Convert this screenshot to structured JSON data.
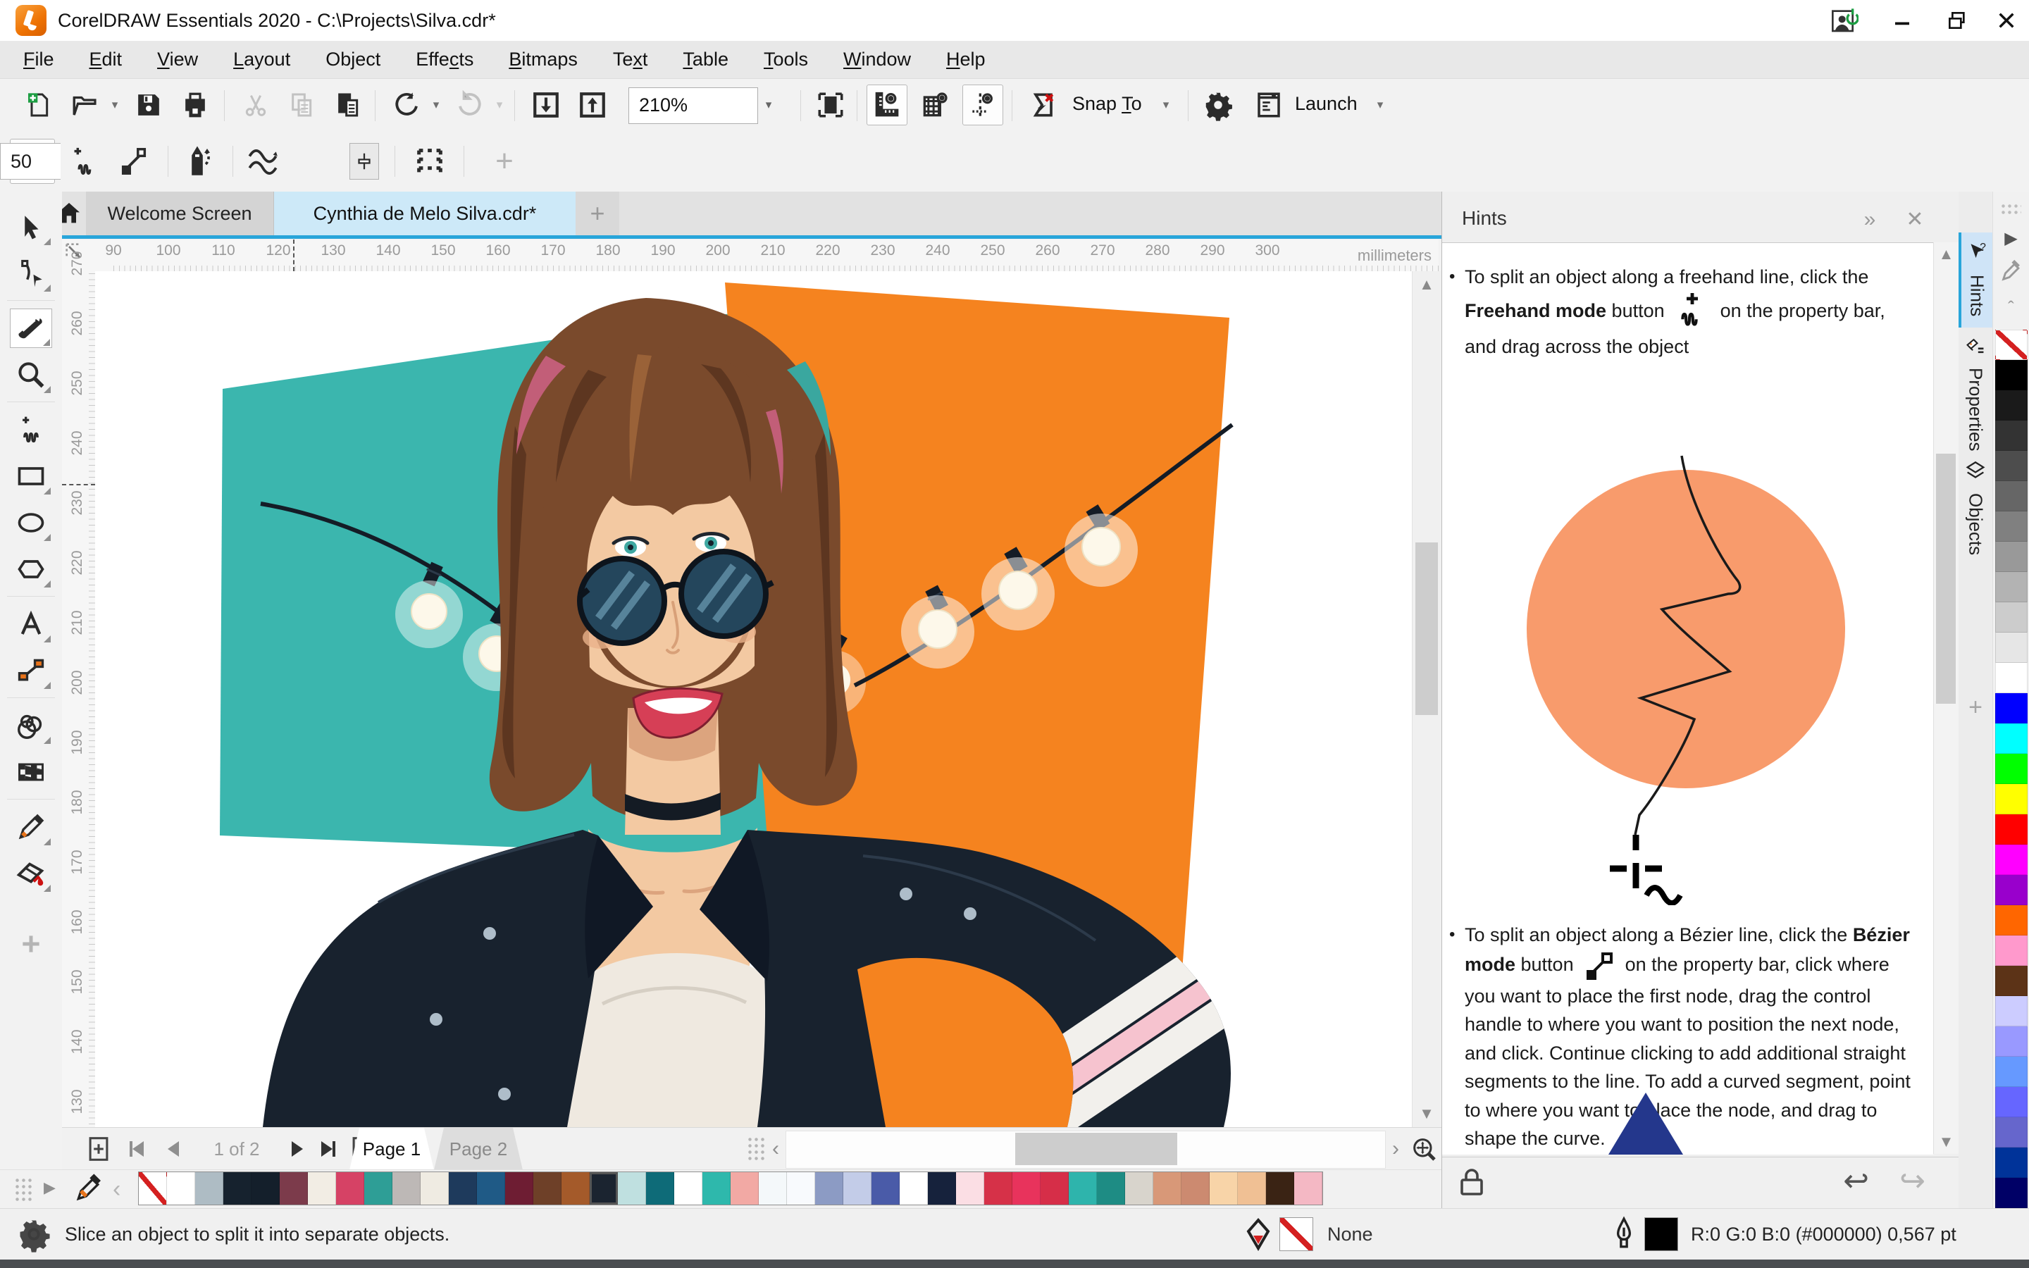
{
  "window": {
    "title": "CorelDRAW Essentials 2020 - C:\\Projects\\Silva.cdr*"
  },
  "menu": {
    "items": [
      {
        "label": "File",
        "underline": 0
      },
      {
        "label": "Edit",
        "underline": 0
      },
      {
        "label": "View",
        "underline": 0
      },
      {
        "label": "Layout",
        "underline": 0
      },
      {
        "label": "Object",
        "underline": 2
      },
      {
        "label": "Effects",
        "underline": 4
      },
      {
        "label": "Bitmaps",
        "underline": 0
      },
      {
        "label": "Text",
        "underline": 2
      },
      {
        "label": "Table",
        "underline": 0
      },
      {
        "label": "Tools",
        "underline": 0
      },
      {
        "label": "Window",
        "underline": 0
      },
      {
        "label": "Help",
        "underline": 0
      }
    ]
  },
  "toolbar": {
    "zoom_level": "210%",
    "snap_to": {
      "label": "Snap To",
      "underline": 5
    },
    "launch": "Launch",
    "icons": [
      "new-document-icon",
      "open-icon",
      "save-icon",
      "print-icon",
      "cut-icon",
      "copy-icon",
      "paste-icon",
      "undo-icon",
      "redo-icon",
      "import-icon",
      "export-icon",
      "page-fit-icon",
      "rulers-icon",
      "grid-icon",
      "guidelines-icon",
      "snap-off-icon",
      "options-gear-icon",
      "launch-icon"
    ]
  },
  "property_bar": {
    "smoothing_value": "50",
    "icons": [
      "two-point-line-icon",
      "freehand-mode-icon",
      "bezier-mode-icon",
      "pencil-curve-icon",
      "smoothing-icon",
      "slider-icon",
      "border-dots-icon",
      "plus-icon"
    ]
  },
  "document_tabs": {
    "welcome": "Welcome Screen",
    "document": "Cynthia de Melo Silva.cdr*"
  },
  "rulers": {
    "units": "millimeters",
    "horizontal_labels": [
      90,
      100,
      110,
      120,
      130,
      140,
      150,
      160,
      170,
      180,
      190,
      200,
      210,
      220,
      230,
      240,
      250,
      260,
      270,
      280,
      290,
      300
    ],
    "vertical_labels": [
      270,
      260,
      250,
      240,
      230,
      220,
      210,
      200,
      190,
      180,
      170,
      160,
      150,
      140,
      130
    ]
  },
  "toolbox": {
    "tools": [
      {
        "name": "pick-tool",
        "flyout": true
      },
      {
        "name": "shape-tool",
        "flyout": true
      },
      {
        "name": "knife-tool",
        "flyout": true,
        "selected": true
      },
      {
        "name": "zoom-tool",
        "flyout": true
      },
      {
        "name": "freehand-tool",
        "flyout": false
      },
      {
        "name": "rectangle-tool",
        "flyout": true
      },
      {
        "name": "ellipse-tool",
        "flyout": true
      },
      {
        "name": "polygon-tool",
        "flyout": true
      },
      {
        "name": "text-tool",
        "flyout": true
      },
      {
        "name": "connector-tool",
        "flyout": true
      },
      {
        "name": "transparency-tool",
        "flyout": true
      },
      {
        "name": "pattern-fill-tool",
        "flyout": false
      },
      {
        "name": "eyedropper-tool",
        "flyout": true
      },
      {
        "name": "interactive-fill-tool",
        "flyout": true
      },
      {
        "name": "add-tool-plus",
        "flyout": false
      }
    ],
    "separators_after": [
      1,
      3,
      7,
      9,
      11
    ]
  },
  "hints": {
    "title": "Hints",
    "bullet1": {
      "prefix": "To split an object along a freehand line, click the ",
      "bold": "Freehand mode",
      "mid": " button ",
      "icon": "freehand-mode-icon",
      "suffix": " on the property bar, and drag across the object"
    },
    "bullet2": {
      "prefix": "To split an object along a Bézier line, click the ",
      "bold": "Bézier mode",
      "mid": " button ",
      "icon": "bezier-mode-icon",
      "suffix": " on the property bar, click where you want to place the first node, drag the control handle to where you want to position the next node, and click. Continue clicking to add additional straight segments to the line. To add a curved segment, point to where you want to place the node, and drag to shape the curve."
    },
    "illustration_circle_color": "#f89b6c",
    "triangle_color": "#24378c"
  },
  "docker_tabs": [
    "Hints",
    "Properties",
    "Objects"
  ],
  "page_navigation": {
    "counter": "1 of 2",
    "pages": [
      "Page 1",
      "Page 2"
    ],
    "active_page": 0
  },
  "status_bar": {
    "message": "Slice an object to split it into separate objects.",
    "fill_label": "None",
    "outline_value": "R:0 G:0 B:0 (#000000)  0,567 pt"
  },
  "palettes": {
    "right": [
      "none",
      "#000000",
      "#1a1a1a",
      "#333333",
      "#4d4d4d",
      "#666666",
      "#808080",
      "#999999",
      "#b3b3b3",
      "#cccccc",
      "#e6e6e6",
      "#ffffff",
      "#0000ff",
      "#00ffff",
      "#00ff00",
      "#ffff00",
      "#ff0000",
      "#ff00ff",
      "#9900cc",
      "#ff6600",
      "#ff99cc",
      "#5c3317",
      "#ccccff",
      "#9999ff",
      "#6699ff",
      "#6666ff",
      "#6666cc",
      "#003399",
      "#000066"
    ],
    "document": [
      "none",
      "#ffffff",
      "#aebcc4",
      "#16222e",
      "#141f2b",
      "#7c3b4b",
      "#f2ede4",
      "#d64265",
      "#2e9e96",
      "#bdb8b6",
      "#efebe2",
      "#1e3a5c",
      "#1f5a86",
      "#6e1d33",
      "#6e4028",
      "#a45a2a",
      "#1b2430",
      "#bfe0e0",
      "#0e6b78",
      "#ffffff",
      "#2eb8ac",
      "#f2a9a4",
      "#f4f8fa",
      "#f8fafd",
      "#8c9bc4",
      "#c3cce8",
      "#4a5ba8",
      "#ffffff",
      "#16223c",
      "#fbdee4",
      "#d63148",
      "#e8335c",
      "#d62e48",
      "#2eb4ac",
      "#1e8c84",
      "#d8d4cc",
      "#d89878",
      "#cc8a70",
      "#f8d4a8",
      "#f0c094",
      "#3a2314",
      "#f4b8c4"
    ],
    "document_selected_index": 16
  },
  "artwork": {
    "background_left_color": "#3bb6ae",
    "background_right_color": "#f5831f",
    "hair_color": "#7a4a2c",
    "skin_color": "#f3c9a2",
    "jacket_color": "#18222e",
    "top_color": "#efe9e0",
    "lips_color": "#d63f56"
  }
}
